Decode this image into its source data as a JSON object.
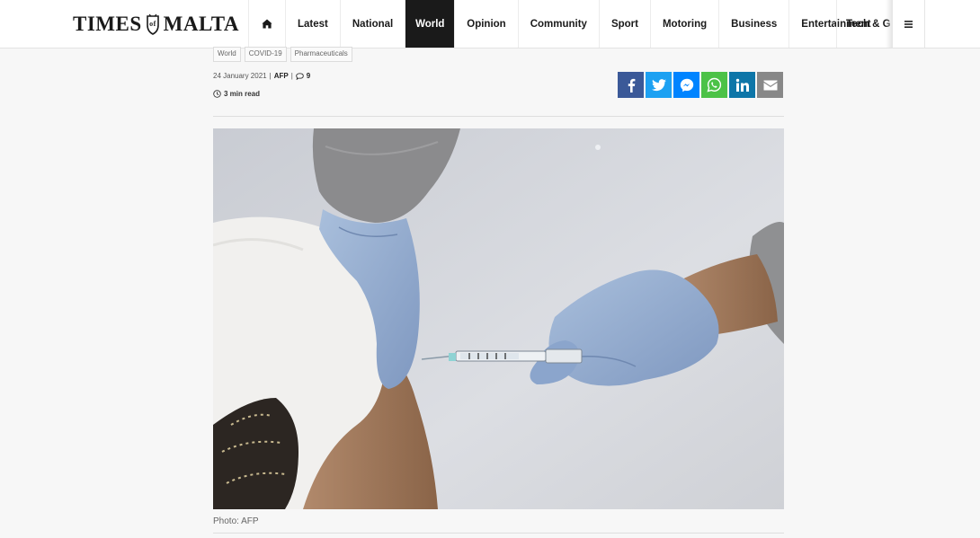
{
  "site": {
    "logo_left": "TIMES",
    "logo_right": "MALTA"
  },
  "nav": {
    "home_icon": "home-icon",
    "items": [
      "Latest",
      "National",
      "World",
      "Opinion",
      "Community",
      "Sport",
      "Motoring",
      "Business",
      "Entertainment"
    ],
    "overflow_item": "Tech & Ga",
    "active": "World",
    "menu_icon": "hamburger-menu-icon"
  },
  "article": {
    "tags": [
      "World",
      "COVID-19",
      "Pharmaceuticals"
    ],
    "date": "24 January 2021",
    "separator": "|",
    "author": "AFP",
    "comment_count": "9",
    "read_time": "3 min read",
    "photo_caption": "Photo: AFP"
  },
  "share": [
    {
      "name": "facebook-icon",
      "color": "#3b5998"
    },
    {
      "name": "twitter-icon",
      "color": "#1da1f2"
    },
    {
      "name": "messenger-icon",
      "color": "#0084ff"
    },
    {
      "name": "whatsapp-icon",
      "color": "#4cc247"
    },
    {
      "name": "linkedin-icon",
      "color": "#0e76a8"
    },
    {
      "name": "email-icon",
      "color": "#888888"
    }
  ],
  "colors": {
    "nav_active_bg": "#1a1a1a",
    "page_bg": "#f7f7f7"
  }
}
